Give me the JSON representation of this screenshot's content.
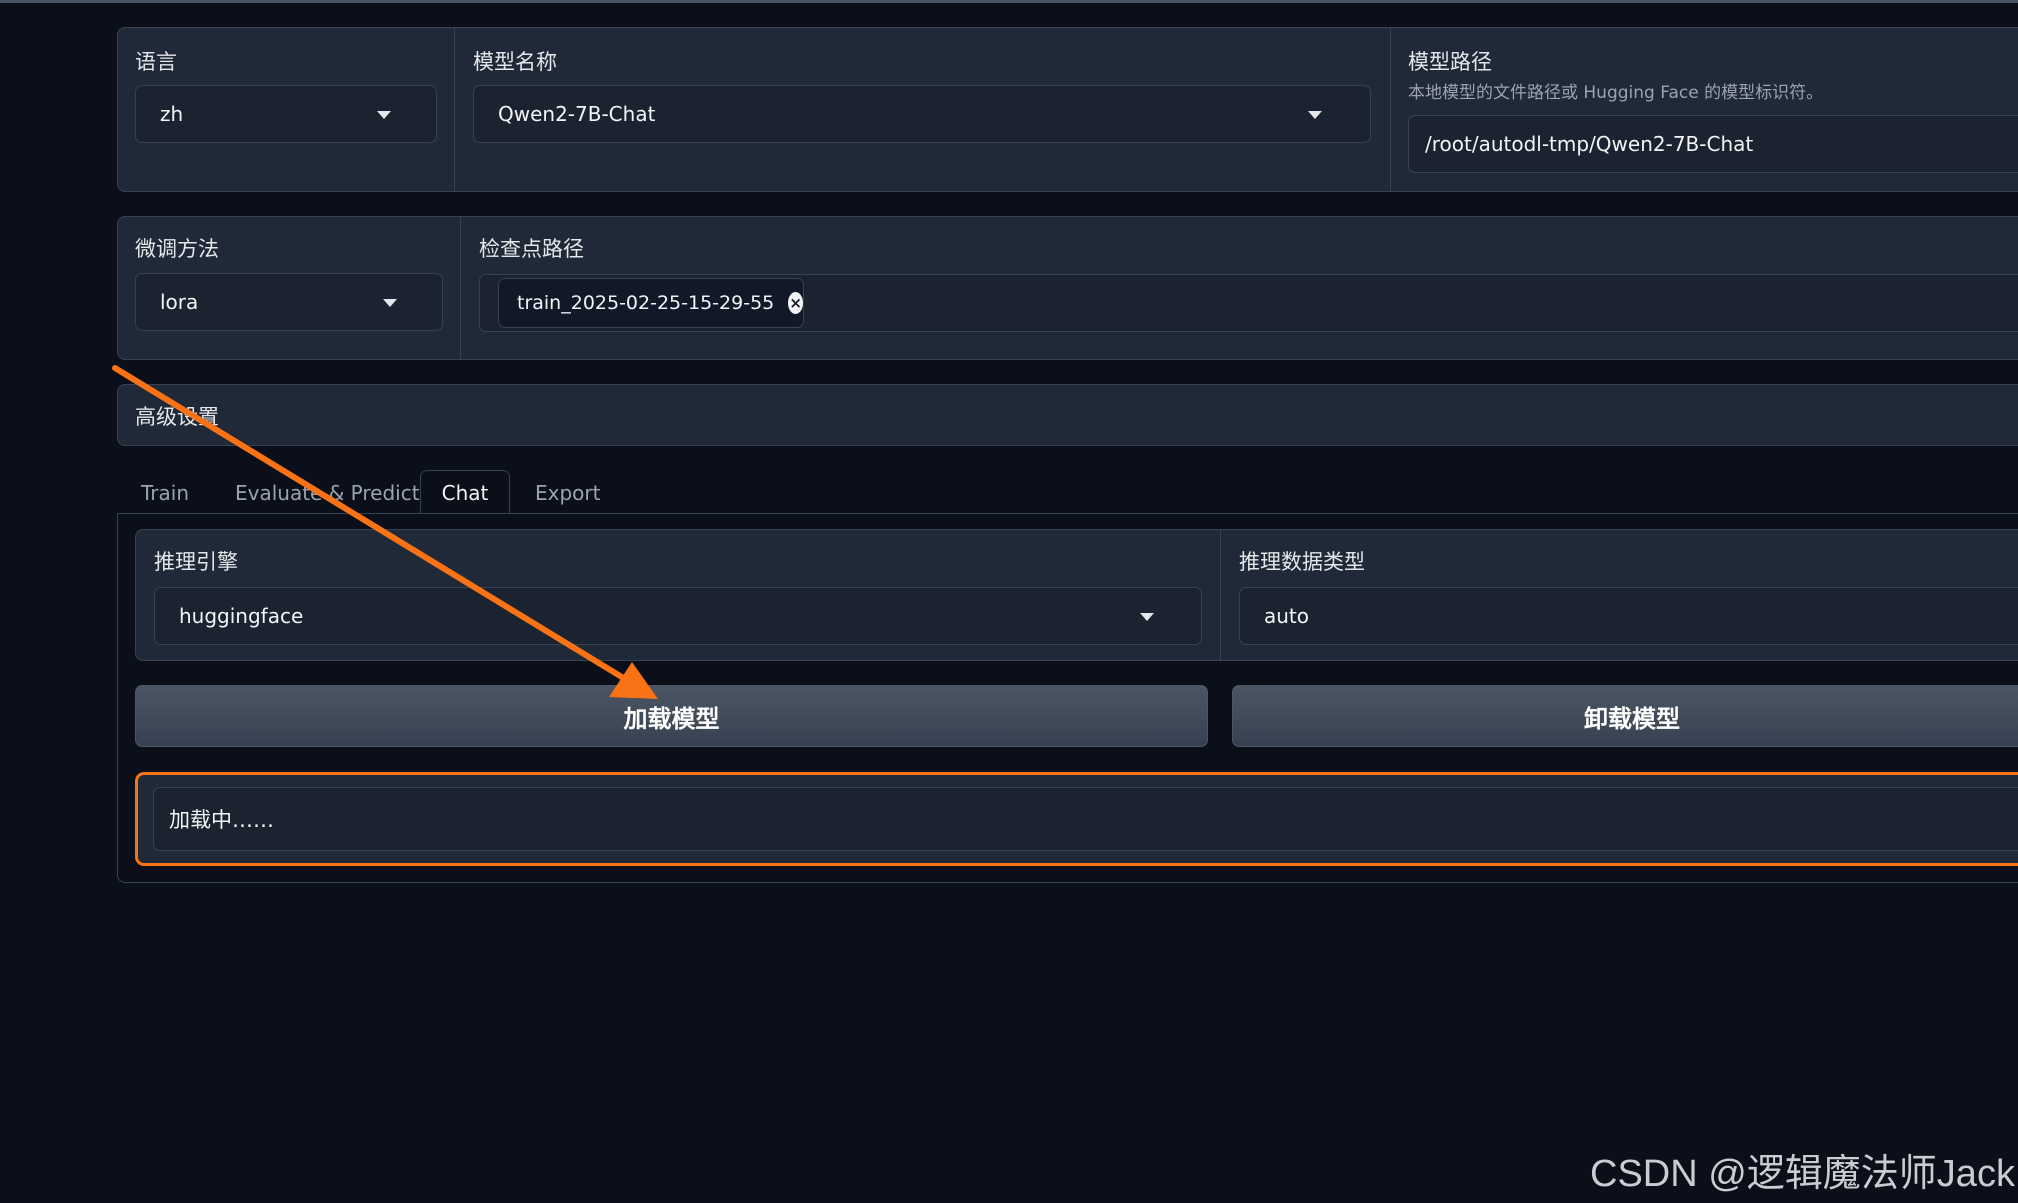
{
  "row1": {
    "language": {
      "label": "语言",
      "value": "zh"
    },
    "model_name": {
      "label": "模型名称",
      "value": "Qwen2-7B-Chat"
    },
    "model_path": {
      "label": "模型路径",
      "info": "本地模型的文件路径或 Hugging Face 的模型标识符。",
      "value": "/root/autodl-tmp/Qwen2-7B-Chat"
    }
  },
  "row2": {
    "finetune": {
      "label": "微调方法",
      "value": "lora"
    },
    "checkpoint": {
      "label": "检查点路径",
      "chip": "train_2025-02-25-15-29-55",
      "chip_close": "×"
    }
  },
  "advanced": {
    "label": "高级设置"
  },
  "tabs": [
    {
      "label": "Train"
    },
    {
      "label": "Evaluate & Predict"
    },
    {
      "label": "Chat"
    },
    {
      "label": "Export"
    }
  ],
  "chat": {
    "engine": {
      "label": "推理引擎",
      "value": "huggingface"
    },
    "dtype": {
      "label": "推理数据类型",
      "value": "auto"
    },
    "load_button": "加载模型",
    "unload_button": "卸载模型",
    "status": "加载中……"
  },
  "watermark": "CSDN @逻辑魔法师Jack",
  "colors": {
    "annotation_arrow": "#f97316",
    "background": "#0b0f19",
    "panel": "#1f2937"
  }
}
